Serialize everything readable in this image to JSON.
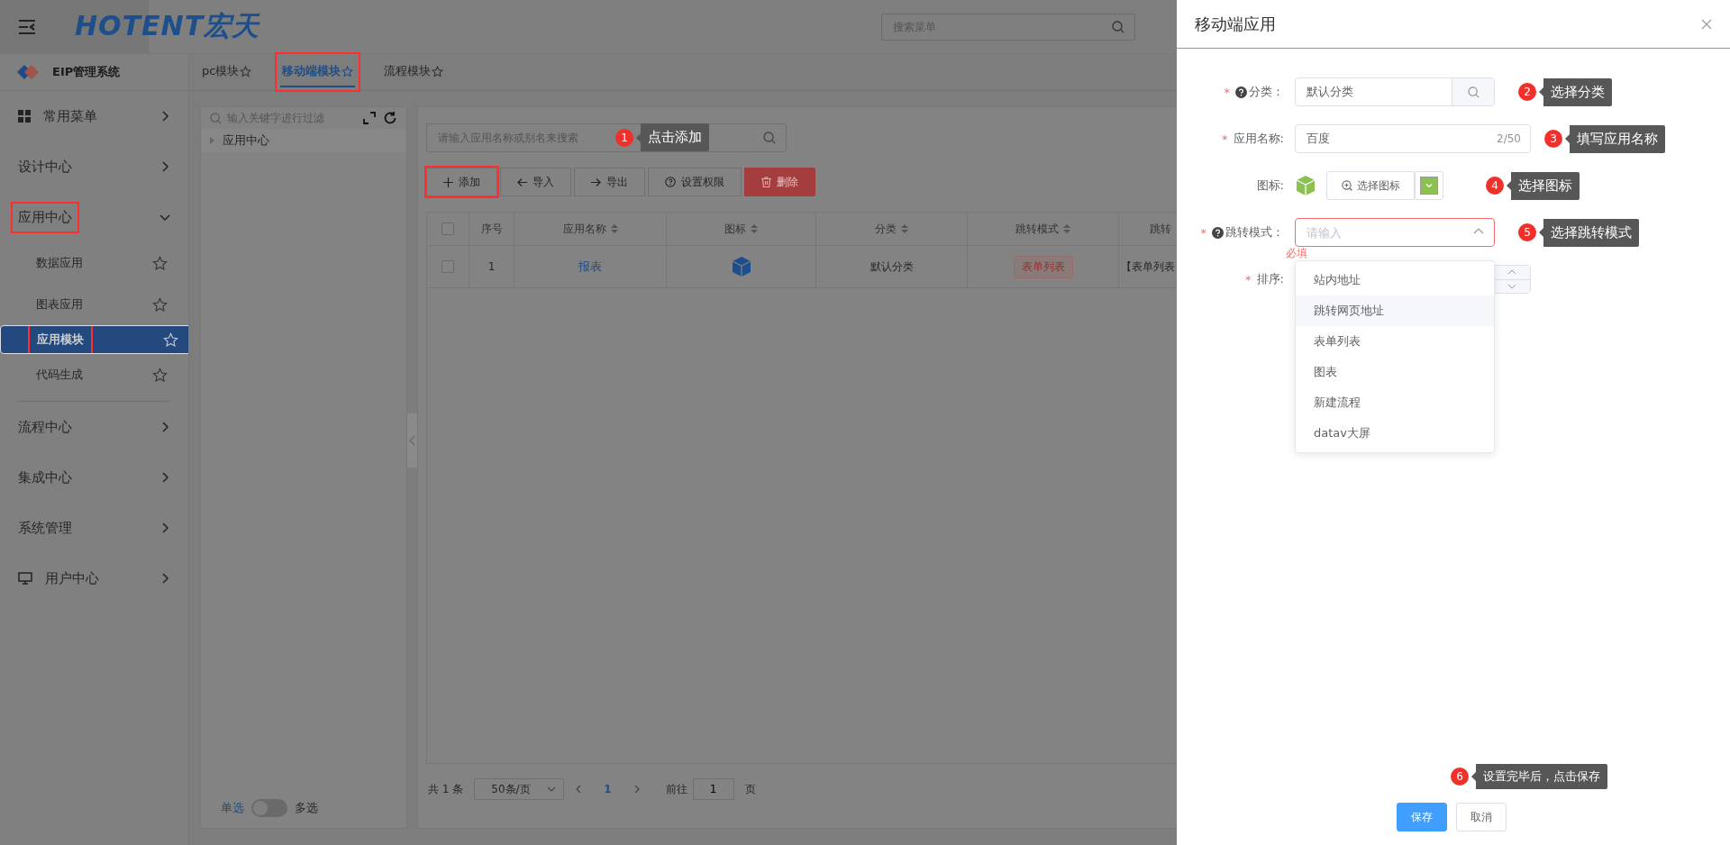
{
  "header": {
    "logo": "HOTENT宏天",
    "search": {
      "placeholder": "搜索菜单"
    }
  },
  "sidebar": {
    "system_name": "EIP管理系统",
    "items": [
      {
        "label": "常用菜单",
        "expanded": false,
        "annotated": false
      },
      {
        "label": "设计中心",
        "expanded": false,
        "annotated": false
      },
      {
        "label": "应用中心",
        "expanded": true,
        "annotated": true,
        "children": [
          {
            "label": "数据应用",
            "selected": false,
            "annotated": false
          },
          {
            "label": "图表应用",
            "selected": false,
            "annotated": false
          },
          {
            "label": "应用模块",
            "selected": true,
            "annotated": true
          },
          {
            "label": "代码生成",
            "selected": false,
            "annotated": false
          }
        ]
      },
      {
        "label": "流程中心",
        "expanded": false,
        "annotated": false
      },
      {
        "label": "集成中心",
        "expanded": false,
        "annotated": false
      },
      {
        "label": "系统管理",
        "expanded": false,
        "annotated": false
      },
      {
        "label": "用户中心",
        "expanded": false,
        "annotated": false
      }
    ]
  },
  "tabs": [
    {
      "label": "pc模块",
      "selected": false,
      "annotated": false
    },
    {
      "label": "移动端模块",
      "selected": true,
      "annotated": true
    },
    {
      "label": "流程模块",
      "selected": false,
      "annotated": false
    }
  ],
  "tree": {
    "filter": {
      "placeholder": "输入关键字进行过滤"
    },
    "nodes": [
      {
        "label": "应用中心",
        "expanded": false
      }
    ],
    "selection_toggle": {
      "off_label": "单选",
      "on_label": "多选",
      "on": false
    }
  },
  "main": {
    "search": {
      "placeholder": "请输入应用名称或别名来搜索",
      "annotation": {
        "number": "1",
        "text": "点击添加"
      }
    },
    "toolbar": [
      {
        "kind": "add",
        "label": "添加",
        "annotated": true
      },
      {
        "kind": "import",
        "label": "导入",
        "annotated": false
      },
      {
        "kind": "export",
        "label": "导出",
        "annotated": false
      },
      {
        "kind": "permission",
        "label": "设置权限",
        "annotated": false
      },
      {
        "kind": "delete",
        "label": "删除",
        "annotated": false
      }
    ],
    "table": {
      "header_checked": false,
      "columns": [
        {
          "label": "序号",
          "sortable": false
        },
        {
          "label": "应用名称",
          "sortable": true
        },
        {
          "label": "图标",
          "sortable": true
        },
        {
          "label": "分类",
          "sortable": true
        },
        {
          "label": "跳转模式",
          "sortable": true
        },
        {
          "label": "跳转"
        }
      ],
      "rows": [
        {
          "checked": false,
          "index": "1",
          "name": "报表",
          "category": "默认分类",
          "mode": "表单列表",
          "column_7": "【表单列表"
        }
      ]
    },
    "pagination": {
      "total": "共 1 条",
      "page_size": "50条/页",
      "pages": [
        {
          "label": "1",
          "selected": true
        }
      ],
      "goto_label": "前往",
      "goto_value": "1",
      "goto_suffix": "页"
    }
  },
  "drawer": {
    "title": "移动端应用",
    "fields": [
      {
        "kind": "search-input",
        "required_mark": "*",
        "label": "分类：",
        "help": true,
        "value": "默认分类",
        "annotation": {
          "number": "2",
          "text": "选择分类"
        }
      },
      {
        "kind": "text-input",
        "required_mark": "*",
        "label": "应用名称:",
        "help": false,
        "value": "百度",
        "counter": "2/50",
        "annotation": {
          "number": "3",
          "text": "填写应用名称"
        }
      },
      {
        "kind": "icon-picker",
        "label": "图标:",
        "help": false,
        "button": "选择图标",
        "annotation": {
          "number": "4",
          "text": "选择图标"
        }
      },
      {
        "kind": "select",
        "required_mark": "*",
        "label": "跳转模式：",
        "help": true,
        "placeholder": "请输入",
        "expanded": true,
        "error": "必填",
        "options": [
          {
            "label": "站内地址",
            "highlighted": false
          },
          {
            "label": "跳转网页地址",
            "highlighted": true
          },
          {
            "label": "表单列表",
            "highlighted": false
          },
          {
            "label": "图表",
            "highlighted": false
          },
          {
            "label": "新建流程",
            "highlighted": false
          },
          {
            "label": "datav大屏",
            "highlighted": false
          }
        ],
        "annotation": {
          "number": "5",
          "text": "选择跳转模式"
        }
      },
      {
        "kind": "number",
        "required_mark": "*",
        "label": "排序:",
        "help": false
      }
    ],
    "buttons": [
      {
        "kind": "primary",
        "label": "保存"
      },
      {
        "kind": "default",
        "label": "取消"
      }
    ],
    "footer_annotation": {
      "number": "6",
      "text": "设置完毕后，点击保存"
    }
  }
}
